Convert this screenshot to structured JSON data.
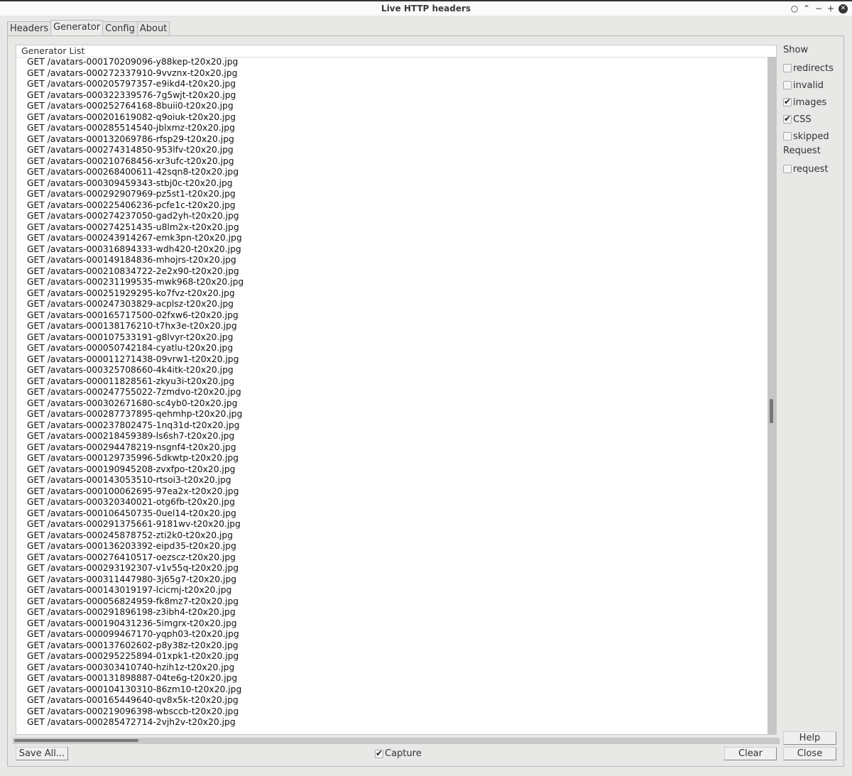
{
  "window": {
    "title": "Live HTTP headers",
    "controls": [
      "pin",
      "shade",
      "minimize",
      "maximize",
      "close"
    ]
  },
  "tabs": [
    {
      "label": "Headers",
      "active": false
    },
    {
      "label": "Generator",
      "active": true
    },
    {
      "label": "Config",
      "active": false
    },
    {
      "label": "About",
      "active": false
    }
  ],
  "generator": {
    "header": "Generator List",
    "rows": [
      "GET /avatars-000170209096-y88kep-t20x20.jpg",
      "GET /avatars-000272337910-9vvznx-t20x20.jpg",
      "GET /avatars-000205797357-e9ikd4-t20x20.jpg",
      "GET /avatars-000322339576-7g5wjt-t20x20.jpg",
      "GET /avatars-000252764168-8buii0-t20x20.jpg",
      "GET /avatars-000201619082-q9oiuk-t20x20.jpg",
      "GET /avatars-000285514540-jblxmz-t20x20.jpg",
      "GET /avatars-000132069786-rfsp29-t20x20.jpg",
      "GET /avatars-000274314850-953lfv-t20x20.jpg",
      "GET /avatars-000210768456-xr3ufc-t20x20.jpg",
      "GET /avatars-000268400611-42sqn8-t20x20.jpg",
      "GET /avatars-000309459343-stbj0c-t20x20.jpg",
      "GET /avatars-000292907969-pz5st1-t20x20.jpg",
      "GET /avatars-000225406236-pcfe1c-t20x20.jpg",
      "GET /avatars-000274237050-gad2yh-t20x20.jpg",
      "GET /avatars-000274251435-u8lm2x-t20x20.jpg",
      "GET /avatars-000243914267-emk3pn-t20x20.jpg",
      "GET /avatars-000316894333-wdh420-t20x20.jpg",
      "GET /avatars-000149184836-mhojrs-t20x20.jpg",
      "GET /avatars-000210834722-2e2x90-t20x20.jpg",
      "GET /avatars-000231199535-mwk968-t20x20.jpg",
      "GET /avatars-000251929295-ko7fvz-t20x20.jpg",
      "GET /avatars-000247303829-acplsz-t20x20.jpg",
      "GET /avatars-000165717500-02fxw6-t20x20.jpg",
      "GET /avatars-000138176210-t7hx3e-t20x20.jpg",
      "GET /avatars-000107533191-g8lvyr-t20x20.jpg",
      "GET /avatars-000050742184-cyatlu-t20x20.jpg",
      "GET /avatars-000011271438-09vrw1-t20x20.jpg",
      "GET /avatars-000325708660-4k4itk-t20x20.jpg",
      "GET /avatars-000011828561-zkyu3i-t20x20.jpg",
      "GET /avatars-000247755022-7zmdvo-t20x20.jpg",
      "GET /avatars-000302671680-sc4yb0-t20x20.jpg",
      "GET /avatars-000287737895-qehmhp-t20x20.jpg",
      "GET /avatars-000237802475-1nq31d-t20x20.jpg",
      "GET /avatars-000218459389-ls6sh7-t20x20.jpg",
      "GET /avatars-000294478219-nsgnf4-t20x20.jpg",
      "GET /avatars-000129735996-5dkwtp-t20x20.jpg",
      "GET /avatars-000190945208-zvxfpo-t20x20.jpg",
      "GET /avatars-000143053510-rtsoi3-t20x20.jpg",
      "GET /avatars-000100062695-97ea2x-t20x20.jpg",
      "GET /avatars-000320340021-otg6fb-t20x20.jpg",
      "GET /avatars-000106450735-0uel14-t20x20.jpg",
      "GET /avatars-000291375661-9181wv-t20x20.jpg",
      "GET /avatars-000245878752-zti2k0-t20x20.jpg",
      "GET /avatars-000136203392-eipd35-t20x20.jpg",
      "GET /avatars-000276410517-oezscz-t20x20.jpg",
      "GET /avatars-000293192307-v1v55q-t20x20.jpg",
      "GET /avatars-000311447980-3j65g7-t20x20.jpg",
      "GET /avatars-000143019197-lcicmj-t20x20.jpg",
      "GET /avatars-000056824959-fk8mz7-t20x20.jpg",
      "GET /avatars-000291896198-z3ibh4-t20x20.jpg",
      "GET /avatars-000190431236-5imgrx-t20x20.jpg",
      "GET /avatars-000099467170-yqph03-t20x20.jpg",
      "GET /avatars-000137602602-p8y38z-t20x20.jpg",
      "GET /avatars-000295225894-01xpk1-t20x20.jpg",
      "GET /avatars-000303410740-hzih1z-t20x20.jpg",
      "GET /avatars-000131898887-04te6g-t20x20.jpg",
      "GET /avatars-000104130310-86zm10-t20x20.jpg",
      "GET /avatars-000165449640-qv8x5k-t20x20.jpg",
      "GET /avatars-000219096398-wbsccb-t20x20.jpg",
      "GET /avatars-000285472714-2vjh2v-t20x20.jpg"
    ]
  },
  "sidebar": {
    "show_label": "Show",
    "show_options": [
      {
        "label": "redirects",
        "checked": false
      },
      {
        "label": "invalid",
        "checked": false
      },
      {
        "label": "images",
        "checked": true
      },
      {
        "label": "CSS",
        "checked": true
      },
      {
        "label": "skipped",
        "checked": false
      }
    ],
    "request_label": "Request",
    "request_options": [
      {
        "label": "request",
        "checked": false
      }
    ]
  },
  "footer": {
    "save_all": "Save All...",
    "capture_label": "Capture",
    "capture_checked": true,
    "clear": "Clear",
    "help": "Help",
    "close": "Close"
  }
}
